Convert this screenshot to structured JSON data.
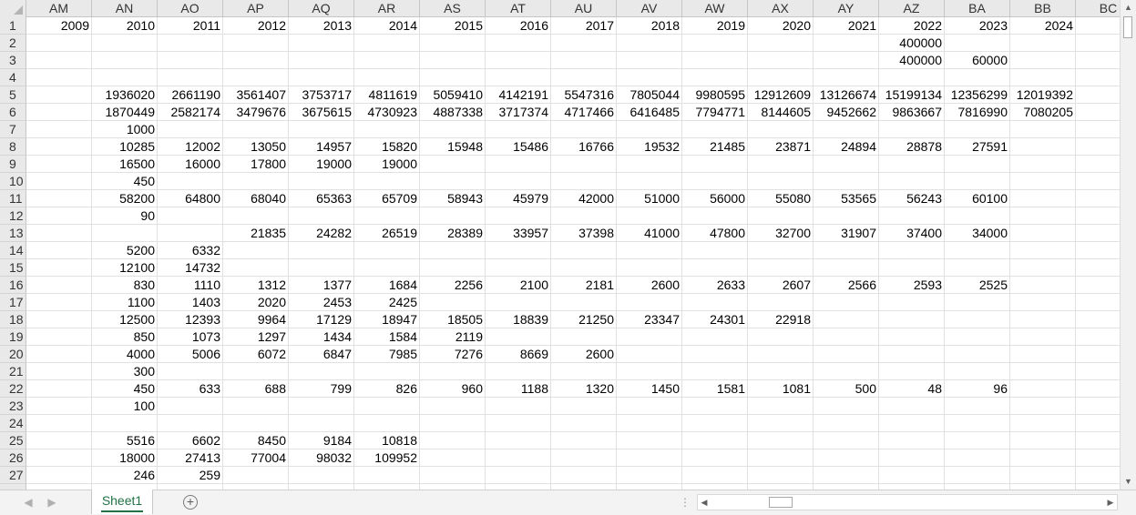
{
  "columns": [
    "AM",
    "AN",
    "AO",
    "AP",
    "AQ",
    "AR",
    "AS",
    "AT",
    "AU",
    "AV",
    "AW",
    "AX",
    "AY",
    "AZ",
    "BA",
    "BB",
    "BC"
  ],
  "rows": [
    {
      "n": "1",
      "cells": [
        "2009",
        "2010",
        "2011",
        "2012",
        "2013",
        "2014",
        "2015",
        "2016",
        "2017",
        "2018",
        "2019",
        "2020",
        "2021",
        "2022",
        "2023",
        "2024",
        ""
      ]
    },
    {
      "n": "2",
      "cells": [
        "",
        "",
        "",
        "",
        "",
        "",
        "",
        "",
        "",
        "",
        "",
        "",
        "",
        "400000",
        "",
        "",
        ""
      ]
    },
    {
      "n": "3",
      "cells": [
        "",
        "",
        "",
        "",
        "",
        "",
        "",
        "",
        "",
        "",
        "",
        "",
        "",
        "400000",
        "60000",
        "",
        ""
      ]
    },
    {
      "n": "4",
      "cells": [
        "",
        "",
        "",
        "",
        "",
        "",
        "",
        "",
        "",
        "",
        "",
        "",
        "",
        "",
        "",
        "",
        ""
      ]
    },
    {
      "n": "5",
      "cells": [
        "",
        "1936020",
        "2661190",
        "3561407",
        "3753717",
        "4811619",
        "5059410",
        "4142191",
        "5547316",
        "7805044",
        "9980595",
        "12912609",
        "13126674",
        "15199134",
        "12356299",
        "12019392",
        ""
      ]
    },
    {
      "n": "6",
      "cells": [
        "",
        "1870449",
        "2582174",
        "3479676",
        "3675615",
        "4730923",
        "4887338",
        "3717374",
        "4717466",
        "6416485",
        "7794771",
        "8144605",
        "9452662",
        "9863667",
        "7816990",
        "7080205",
        ""
      ]
    },
    {
      "n": "7",
      "cells": [
        "",
        "1000",
        "",
        "",
        "",
        "",
        "",
        "",
        "",
        "",
        "",
        "",
        "",
        "",
        "",
        "",
        ""
      ]
    },
    {
      "n": "8",
      "cells": [
        "",
        "10285",
        "12002",
        "13050",
        "14957",
        "15820",
        "15948",
        "15486",
        "16766",
        "19532",
        "21485",
        "23871",
        "24894",
        "28878",
        "27591",
        "",
        ""
      ]
    },
    {
      "n": "9",
      "cells": [
        "",
        "16500",
        "16000",
        "17800",
        "19000",
        "19000",
        "",
        "",
        "",
        "",
        "",
        "",
        "",
        "",
        "",
        "",
        ""
      ]
    },
    {
      "n": "10",
      "cells": [
        "",
        "450",
        "",
        "",
        "",
        "",
        "",
        "",
        "",
        "",
        "",
        "",
        "",
        "",
        "",
        "",
        ""
      ]
    },
    {
      "n": "11",
      "cells": [
        "",
        "58200",
        "64800",
        "68040",
        "65363",
        "65709",
        "58943",
        "45979",
        "42000",
        "51000",
        "56000",
        "55080",
        "53565",
        "56243",
        "60100",
        "",
        ""
      ]
    },
    {
      "n": "12",
      "cells": [
        "",
        "90",
        "",
        "",
        "",
        "",
        "",
        "",
        "",
        "",
        "",
        "",
        "",
        "",
        "",
        "",
        ""
      ]
    },
    {
      "n": "13",
      "cells": [
        "",
        "",
        "",
        "21835",
        "24282",
        "26519",
        "28389",
        "33957",
        "37398",
        "41000",
        "47800",
        "32700",
        "31907",
        "37400",
        "34000",
        "",
        ""
      ]
    },
    {
      "n": "14",
      "cells": [
        "",
        "5200",
        "6332",
        "",
        "",
        "",
        "",
        "",
        "",
        "",
        "",
        "",
        "",
        "",
        "",
        "",
        ""
      ]
    },
    {
      "n": "15",
      "cells": [
        "",
        "12100",
        "14732",
        "",
        "",
        "",
        "",
        "",
        "",
        "",
        "",
        "",
        "",
        "",
        "",
        "",
        ""
      ]
    },
    {
      "n": "16",
      "cells": [
        "",
        "830",
        "1110",
        "1312",
        "1377",
        "1684",
        "2256",
        "2100",
        "2181",
        "2600",
        "2633",
        "2607",
        "2566",
        "2593",
        "2525",
        "",
        ""
      ]
    },
    {
      "n": "17",
      "cells": [
        "",
        "1100",
        "1403",
        "2020",
        "2453",
        "2425",
        "",
        "",
        "",
        "",
        "",
        "",
        "",
        "",
        "",
        "",
        ""
      ]
    },
    {
      "n": "18",
      "cells": [
        "",
        "12500",
        "12393",
        "9964",
        "17129",
        "18947",
        "18505",
        "18839",
        "21250",
        "23347",
        "24301",
        "22918",
        "",
        "",
        "",
        "",
        ""
      ]
    },
    {
      "n": "19",
      "cells": [
        "",
        "850",
        "1073",
        "1297",
        "1434",
        "1584",
        "2119",
        "",
        "",
        "",
        "",
        "",
        "",
        "",
        "",
        "",
        ""
      ]
    },
    {
      "n": "20",
      "cells": [
        "",
        "4000",
        "5006",
        "6072",
        "6847",
        "7985",
        "7276",
        "8669",
        "2600",
        "",
        "",
        "",
        "",
        "",
        "",
        "",
        ""
      ]
    },
    {
      "n": "21",
      "cells": [
        "",
        "300",
        "",
        "",
        "",
        "",
        "",
        "",
        "",
        "",
        "",
        "",
        "",
        "",
        "",
        "",
        ""
      ]
    },
    {
      "n": "22",
      "cells": [
        "",
        "450",
        "633",
        "688",
        "799",
        "826",
        "960",
        "1188",
        "1320",
        "1450",
        "1581",
        "1081",
        "500",
        "48",
        "96",
        "",
        ""
      ]
    },
    {
      "n": "23",
      "cells": [
        "",
        "100",
        "",
        "",
        "",
        "",
        "",
        "",
        "",
        "",
        "",
        "",
        "",
        "",
        "",
        "",
        ""
      ]
    },
    {
      "n": "24",
      "cells": [
        "",
        "",
        "",
        "",
        "",
        "",
        "",
        "",
        "",
        "",
        "",
        "",
        "",
        "",
        "",
        "",
        ""
      ]
    },
    {
      "n": "25",
      "cells": [
        "",
        "5516",
        "6602",
        "8450",
        "9184",
        "10818",
        "",
        "",
        "",
        "",
        "",
        "",
        "",
        "",
        "",
        "",
        ""
      ]
    },
    {
      "n": "26",
      "cells": [
        "",
        "18000",
        "27413",
        "77004",
        "98032",
        "109952",
        "",
        "",
        "",
        "",
        "",
        "",
        "",
        "",
        "",
        "",
        ""
      ]
    },
    {
      "n": "27",
      "cells": [
        "",
        "246",
        "259",
        "",
        "",
        "",
        "",
        "",
        "",
        "",
        "",
        "",
        "",
        "",
        "",
        "",
        ""
      ]
    }
  ],
  "sheet_tab": "Sheet1",
  "add_sheet_symbol": "+",
  "icons": {
    "scroll_up": "up-arrow-icon",
    "scroll_down": "down-arrow-icon",
    "nav_prev": "left-triangle-icon",
    "nav_next": "right-triangle-icon",
    "add_sheet": "plus-circle-icon"
  },
  "colors": {
    "header_bg": "#e9e9e9",
    "active_tab": "#217346",
    "gridline": "#e1e1e1"
  }
}
